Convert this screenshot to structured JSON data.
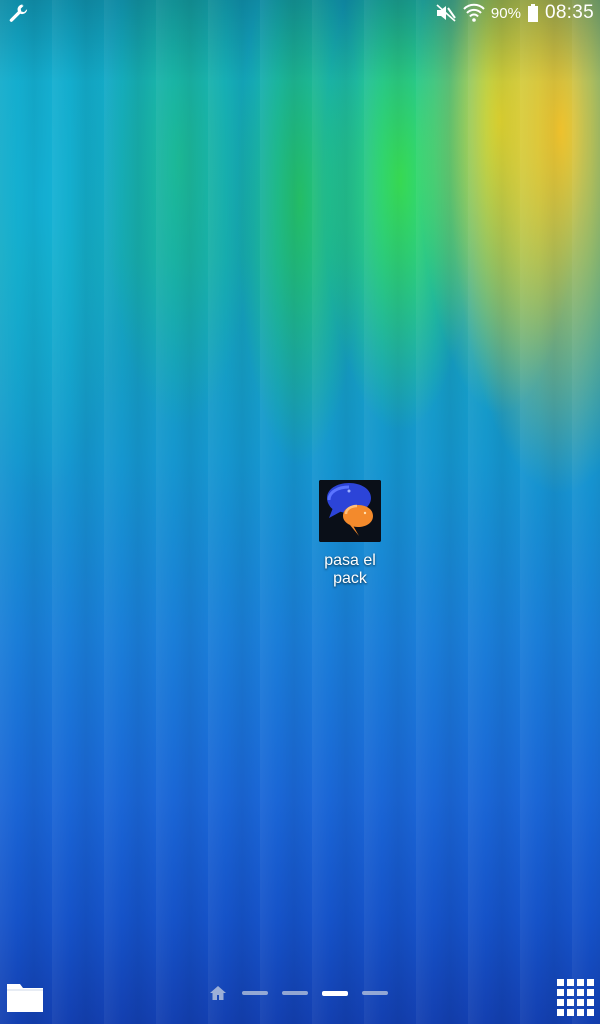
{
  "status_bar": {
    "left_icon": "wrench-icon",
    "icons": [
      "mute-icon",
      "wifi-icon"
    ],
    "battery_percent": "90%",
    "battery_icon": "battery-icon",
    "time": "08:35"
  },
  "home_screen": {
    "apps": [
      {
        "label": "pasa el pack",
        "icon": "chat-bubbles-icon"
      }
    ]
  },
  "bottom_bar": {
    "left_button_icon": "folder-icon",
    "page_indicator": {
      "home_icon": "home-icon",
      "pages": 4,
      "active_page": 3
    },
    "right_button_icon": "apps-grid-icon"
  }
}
